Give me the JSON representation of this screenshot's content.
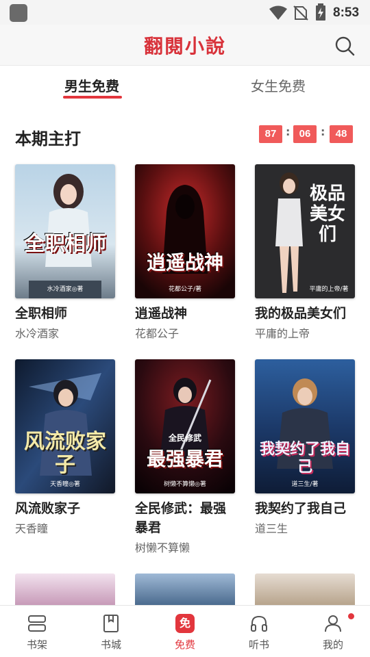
{
  "status_bar": {
    "time": "8:53"
  },
  "header": {
    "app_title": "翻閱小說"
  },
  "tabs": [
    {
      "label": "男生免费",
      "active": true
    },
    {
      "label": "女生免费",
      "active": false
    }
  ],
  "section": {
    "title": "本期主打",
    "countdown": {
      "hours": "87",
      "minutes": "06",
      "seconds": "48",
      "separator": ":"
    }
  },
  "books": [
    {
      "title": "全职相师",
      "author": "水冷酒家",
      "cover_text": "全职相师",
      "cover_author": "水冷酒家◎著"
    },
    {
      "title": "逍遥战神",
      "author": "花都公子",
      "cover_text": "逍遥战神",
      "cover_author": "花都公子/著"
    },
    {
      "title": "我的极品美女们",
      "author": "平庸的上帝",
      "cover_text": "极品美女们",
      "cover_author": "平庸的上帝/著"
    },
    {
      "title": "风流败家子",
      "author": "天香瞳",
      "cover_text": "风流败家子",
      "cover_author": "天香瞳◎著"
    },
    {
      "title": "全民修武：最强暴君",
      "author": "树懒不算懒",
      "cover_text": "最强暴君",
      "cover_author": "树懒不算懒◎著",
      "cover_subtitle": "全民修武"
    },
    {
      "title": "我契约了我自己",
      "author": "道三生",
      "cover_text": "我契约了我自己",
      "cover_author": "道三生/著"
    }
  ],
  "bottom_nav": [
    {
      "label": "书架",
      "icon": "bookshelf-icon"
    },
    {
      "label": "书城",
      "icon": "bookstore-icon"
    },
    {
      "label": "免费",
      "icon": "free-icon",
      "active": true,
      "icon_text": "免"
    },
    {
      "label": "听书",
      "icon": "headphones-icon"
    },
    {
      "label": "我的",
      "icon": "profile-icon"
    }
  ],
  "colors": {
    "accent": "#e2363d",
    "timer": "#f05a5a"
  }
}
